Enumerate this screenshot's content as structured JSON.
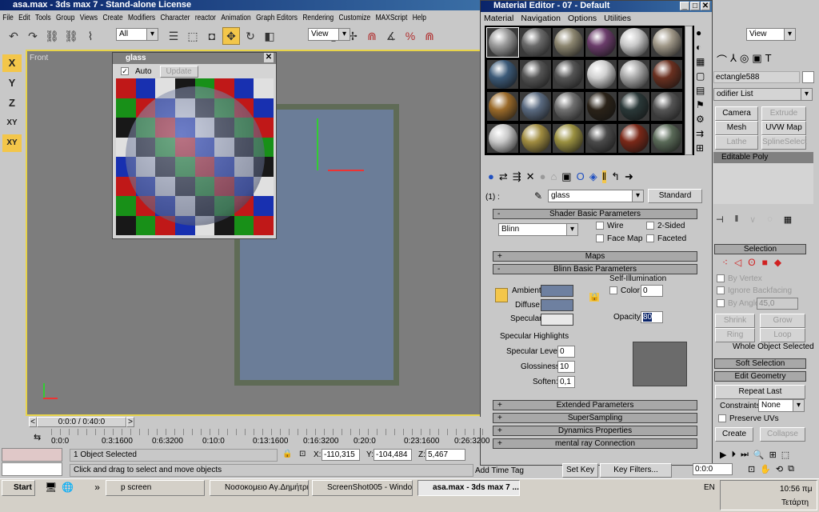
{
  "app": {
    "title": "asa.max - 3ds max 7  - Stand-alone License",
    "menu": [
      "File",
      "Edit",
      "Tools",
      "Group",
      "Views",
      "Create",
      "Modifiers",
      "Character",
      "reactor",
      "Animation",
      "Graph Editors",
      "Rendering",
      "Customize",
      "MAXScript",
      "Help"
    ],
    "selection_filter": "All",
    "ref_coord": "View",
    "render_view": "View"
  },
  "axes": [
    "X",
    "Y",
    "Z",
    "XY",
    "XY"
  ],
  "viewport": {
    "label": "Front"
  },
  "glass_window": {
    "title": "glass",
    "auto_label": "Auto",
    "auto_checked": true,
    "update_label": "Update"
  },
  "material_editor": {
    "title": "Material Editor - 07 - Default",
    "menu": [
      "Material",
      "Navigation",
      "Options",
      "Utilities"
    ],
    "slot_colors": [
      "#9a9a9a",
      "#6a6a6a",
      "#8c8670",
      "#6a3c6a",
      "#c8c8c8",
      "#a09888",
      "#3c5a78",
      "#555555",
      "#555555",
      "#d0d0d0",
      "#a8a8a8",
      "#6a3020",
      "#9a6a2a",
      "#5a6a80",
      "#707070",
      "#2a2218",
      "#2a3838",
      "#555555",
      "#c8c8c8",
      "#a08c40",
      "#9a9040",
      "#4a4a4a",
      "#7a2818",
      "#5a6a58"
    ],
    "material_index": "(1) :",
    "material_name": "glass",
    "material_type": "Standard",
    "rollouts": {
      "shader": "Shader Basic Parameters",
      "maps": "Maps",
      "blinn": "Blinn Basic Parameters",
      "extended": "Extended Parameters",
      "supersampling": "SuperSampling",
      "dynamics": "Dynamics Properties",
      "mentalray": "mental ray Connection"
    },
    "shader": "Blinn",
    "wire": "Wire",
    "two_sided": "2-Sided",
    "face_map": "Face Map",
    "faceted": "Faceted",
    "ambient": "Ambient:",
    "diffuse": "Diffuse:",
    "specular": "Specular:",
    "ambient_color": "#6e80a0",
    "diffuse_color": "#6e80a0",
    "specular_color": "#e8e8e8",
    "self_illum": "Self-Illumination",
    "color_label": "Color",
    "self_illum_value": "0",
    "opacity_label": "Opacity:",
    "opacity": "80",
    "spec_highlights": "Specular Highlights",
    "spec_level_label": "Specular Level:",
    "spec_level": "0",
    "gloss_label": "Glossiness:",
    "gloss": "10",
    "soften_label": "Soften:",
    "soften": "0,1"
  },
  "command_panel": {
    "object_name": "ectangle588",
    "modifier_list": "odifier List",
    "buttons": [
      "Camera Map",
      "Extrude",
      "Mesh Select",
      "UVW Map",
      "Lathe",
      "SplineSelect"
    ],
    "stack_item": "Editable Poly",
    "selection": "Selection",
    "by_vertex": "By Vertex",
    "ignore_backfacing": "Ignore Backfacing",
    "by_angle": "By Angle:",
    "angle": "45,0",
    "shrink": "Shrink",
    "grow": "Grow",
    "ring": "Ring",
    "loop": "Loop",
    "status": "Whole Object Selected",
    "soft_selection": "Soft Selection",
    "edit_geometry": "Edit Geometry",
    "repeat_last": "Repeat Last",
    "constraints_label": "Constraints:",
    "constraints": "None",
    "preserve_uvs": "Preserve UVs",
    "create": "Create",
    "collapse": "Collapse"
  },
  "timeline": {
    "slider": "0:0:0 / 0:40:0",
    "ticks": [
      "0:0:0",
      "0:3:1600",
      "0:6:3200",
      "0:10:0",
      "0:13:1600",
      "0:16:3200",
      "0:20:0",
      "0:23:1600",
      "0:26:3200"
    ]
  },
  "status": {
    "selected": "1 Object Selected",
    "prompt": "Click and drag to select and move objects",
    "x_label": "X:",
    "x": "-110,315",
    "y_label": "Y:",
    "y": "-104,484",
    "z_label": "Z:",
    "z": "5,467",
    "add_time_tag": "Add Time Tag",
    "set_key": "Set Key",
    "key_filters": "Key Filters...",
    "time": "0:0:0"
  },
  "taskbar": {
    "start": "Start",
    "items": [
      "p screen",
      "Νοσοκομειο Αγ.Δημήτριος",
      "ScreenShot005 - Windo...",
      "asa.max - 3ds max 7 ..."
    ],
    "lang": "EN",
    "clock": "10:56 πμ",
    "day": "Τετάρτη"
  }
}
